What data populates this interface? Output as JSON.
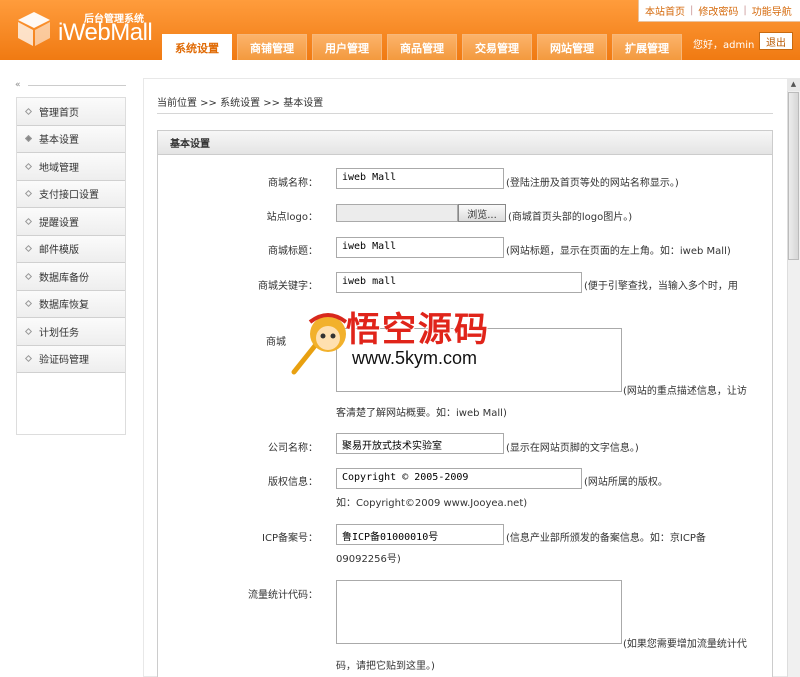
{
  "header": {
    "logo_sub": "后台管理系统",
    "logo_main": "iWebMall",
    "top_links": [
      "本站首页",
      "修改密码",
      "功能导航"
    ],
    "tabs": [
      "系统设置",
      "商铺管理",
      "用户管理",
      "商品管理",
      "交易管理",
      "网站管理",
      "扩展管理"
    ],
    "greeting": "您好，admin",
    "logout": "退出"
  },
  "sidebar": {
    "collapse_glyph": "«",
    "items": [
      "管理首页",
      "基本设置",
      "地域管理",
      "支付接口设置",
      "提醒设置",
      "邮件模版",
      "数据库备份",
      "数据库恢复",
      "计划任务",
      "验证码管理"
    ]
  },
  "breadcrumb": "当前位置 >> 系统设置 >> 基本设置",
  "panel_title": "基本设置",
  "form": {
    "shop_name": {
      "label": "商城名称：",
      "value": "iweb Mall",
      "hint": "(登陆注册及首页等处的网站名称显示。)"
    },
    "logo": {
      "label": "站点logo：",
      "browse": "浏览...",
      "hint": "(商城首页头部的logo图片。)"
    },
    "title": {
      "label": "商城标题：",
      "value": "iweb Mall",
      "hint": "(网站标题，显示在页面的左上角。如：iweb Mall)"
    },
    "keywords": {
      "label": "商城关键字：",
      "value": "iweb mall",
      "hint": "(便于引擎查找，当输入多个时，用"
    },
    "description": {
      "label": "商城",
      "hint": "(网站的重点描述信息，让访",
      "hint2": "客清楚了解网站概要。如：iweb Mall)"
    },
    "company": {
      "label": "公司名称：",
      "value": "聚易开放式技术实验室",
      "hint": "(显示在网站页脚的文字信息。)"
    },
    "copyright": {
      "label": "版权信息：",
      "value": "Copyright © 2005-2009",
      "hint": "(网站所属的版权。",
      "hint2": "如：Copyright©2009 www.Jooyea.net)"
    },
    "icp": {
      "label": "ICP备案号：",
      "value": "鲁ICP备01000010号",
      "hint": "(信息产业部所颁发的备案信息。如：京ICP备",
      "hint2": "09092256号)"
    },
    "stats": {
      "label": "流量统计代码：",
      "hint": "(如果您需要增加流量统计代",
      "hint2": "码，请把它贴到这里。)"
    }
  },
  "watermark": {
    "text": "悟空源码",
    "url": "www.5kym.com"
  },
  "scrollbar": {
    "up_glyph": "▲"
  },
  "colors": {
    "accent": "#f07a12",
    "nav_active_text": "#e06b06"
  }
}
